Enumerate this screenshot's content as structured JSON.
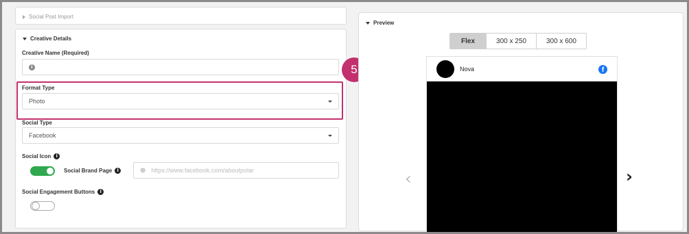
{
  "left": {
    "social_post_import": "Social Post Import",
    "creative_details": "Creative Details",
    "creative_name_label": "Creative Name (Required)",
    "format_type_label": "Format Type",
    "format_type_value": "Photo",
    "social_type_label": "Social Type",
    "social_type_value": "Facebook",
    "social_icon_label": "Social Icon",
    "social_brand_page_label": "Social Brand Page",
    "social_brand_page_placeholder": "https://www.facebook.com/aboutpolar",
    "social_engagement_label": "Social Engagement Buttons"
  },
  "annotation": {
    "step_number": "5"
  },
  "preview": {
    "title": "Preview",
    "tabs": [
      "Flex",
      "300 x 250",
      "300 x 600"
    ],
    "active_tab": "Flex",
    "brand_name": "Nova",
    "social_icon": "facebook-icon"
  },
  "colors": {
    "highlight": "#c2306d",
    "toggle_on": "#2fa84f",
    "facebook": "#1877f2"
  }
}
